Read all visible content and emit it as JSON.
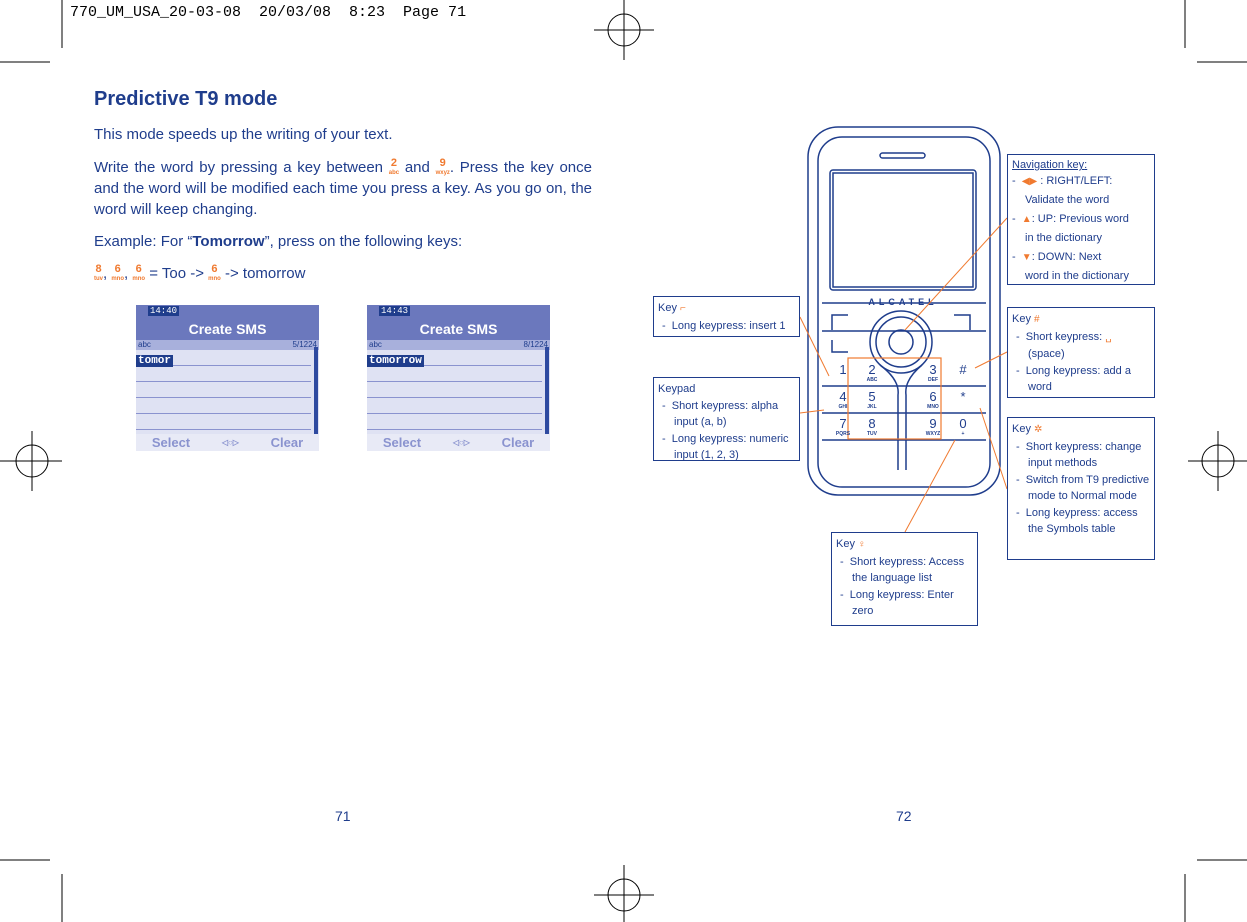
{
  "slug": "770_UM_USA_20-03-08  20/03/08  8:23  Page 71",
  "left_page": {
    "title": "Predictive T9 mode",
    "para1": "This mode speeds up the writing of your text.",
    "para2_a": "Write the word by pressing a key between",
    "para2_b": "and",
    "para2_c": ". Press the key once and the word will be modified each time you press a key. As you go on, the word will keep changing.",
    "example_a": "Example: For “",
    "example_word": "Tomorrow",
    "example_b": "”, press on the following keys:",
    "seq_a": "= Too ->",
    "seq_b": "-> tomorrow",
    "key2": {
      "digit": "2",
      "letters": "abc"
    },
    "key9": {
      "digit": "9",
      "letters": "wxyz"
    },
    "key8": {
      "digit": "8",
      "letters": "tuv"
    },
    "key6": {
      "digit": "6",
      "letters": "mno"
    },
    "screens": [
      {
        "time": "14:40",
        "title": "Create SMS",
        "mode": "abc",
        "count": "5/1224",
        "word": "tomor",
        "left_soft": "Select",
        "right_soft": "Clear"
      },
      {
        "time": "14:43",
        "title": "Create SMS",
        "mode": "abc",
        "count": "8/1224",
        "word": "tomorrow",
        "left_soft": "Select",
        "right_soft": "Clear"
      }
    ],
    "page_number": "71"
  },
  "right_page": {
    "phone": {
      "brand": "ALCATEL",
      "keys": [
        {
          "d": "1",
          "l": ""
        },
        {
          "d": "2",
          "l": "ABC"
        },
        {
          "d": "3",
          "l": "DEF"
        },
        {
          "d": "#",
          "l": ""
        },
        {
          "d": "4",
          "l": "GHI"
        },
        {
          "d": "5",
          "l": "JKL"
        },
        {
          "d": "6",
          "l": "MNO"
        },
        {
          "d": "*",
          "l": ""
        },
        {
          "d": "7",
          "l": "PQRS"
        },
        {
          "d": "8",
          "l": "TUV"
        },
        {
          "d": "9",
          "l": "WXYZ"
        },
        {
          "d": "0",
          "l": "+"
        }
      ]
    },
    "nav_box": {
      "title": "Navigation key",
      "items": [
        ": RIGHT/LEFT:",
        "Validate the word",
        ": UP: Previous word",
        "in the dictionary",
        ": DOWN: Next",
        "word in the dictionary"
      ]
    },
    "key1_box": {
      "title": "Key",
      "items": [
        "Long keypress: insert 1"
      ]
    },
    "keypad_box": {
      "title": "Keypad",
      "items": [
        "Short keypress: alpha input (a, b)",
        "Long keypress: numeric input (1, 2, 3)"
      ]
    },
    "hash_box": {
      "title": "Key",
      "items": [
        "Short keypress:",
        "(space)",
        "Long keypress: add a word"
      ]
    },
    "star_box": {
      "title": "Key",
      "items": [
        "Short keypress: change input methods",
        "Switch from T9 predictive mode to Normal mode",
        "Long keypress: access the Symbols table"
      ]
    },
    "zero_box": {
      "title": "Key",
      "items": [
        "Short keypress: Access the language list",
        "Long keypress: Enter zero"
      ]
    },
    "page_number": "72"
  },
  "colors": {
    "text": "#1f3d8c",
    "accent": "#f07a30",
    "screen_header": "#6b78bd"
  }
}
